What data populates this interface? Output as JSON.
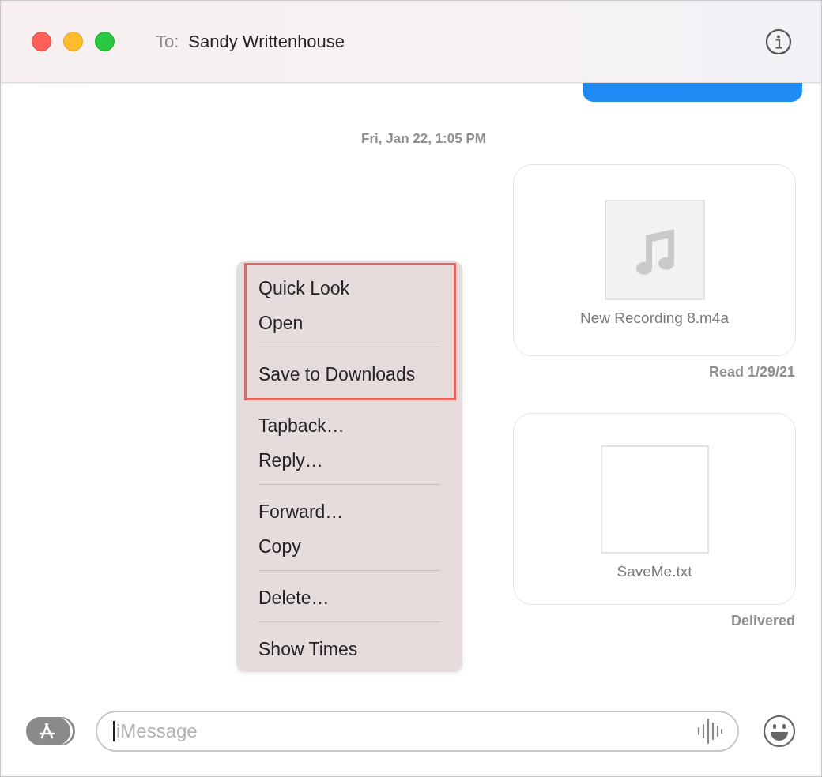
{
  "header": {
    "to_label": "To:",
    "recipient": "Sandy Writtenhouse"
  },
  "conversation": [
    {
      "kind": "sent_bubble_clipped"
    },
    {
      "kind": "timestamp",
      "text": "Fri, Jan 22, 1:05 PM"
    },
    {
      "kind": "audio_attachment",
      "filename": "New Recording 8.m4a",
      "status": "Read 1/29/21"
    },
    {
      "kind": "document_attachment",
      "filename": "SaveMe.txt",
      "status": "Delivered"
    }
  ],
  "context_menu": {
    "outlined_groups": [
      [
        "Quick Look",
        "Open"
      ],
      [
        "Save to Downloads"
      ]
    ],
    "groups": [
      [
        "Tapback…",
        "Reply…"
      ],
      [
        "Forward…",
        "Copy"
      ],
      [
        "Delete…"
      ],
      [
        "Show Times"
      ]
    ]
  },
  "composer": {
    "placeholder": "iMessage"
  }
}
